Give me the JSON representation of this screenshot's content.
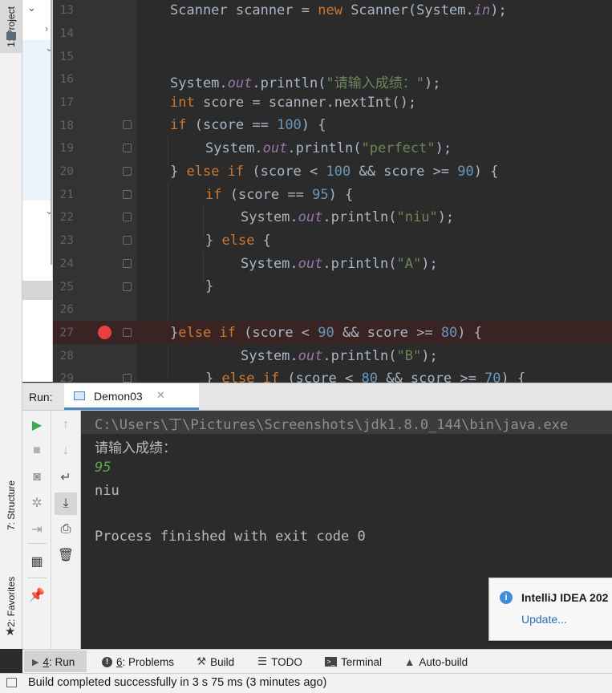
{
  "left_strip": {
    "project_tab": "1: Project",
    "structure_tab": "7: Structure",
    "favorites_tab": "2: Favorites"
  },
  "editor": {
    "lines": [
      {
        "num": "13"
      },
      {
        "num": "14"
      },
      {
        "num": "15"
      },
      {
        "num": "16"
      },
      {
        "num": "17"
      },
      {
        "num": "18"
      },
      {
        "num": "19"
      },
      {
        "num": "20"
      },
      {
        "num": "21"
      },
      {
        "num": "22"
      },
      {
        "num": "23"
      },
      {
        "num": "24"
      },
      {
        "num": "25"
      },
      {
        "num": "26"
      },
      {
        "num": "27"
      },
      {
        "num": "28"
      },
      {
        "num": "29"
      }
    ],
    "tokens": {
      "l13": [
        "Scanner scanner = ",
        "new",
        " Scanner(System.",
        "in",
        ");"
      ],
      "l16": [
        "System.",
        "out",
        ".println(",
        "\"请输入成绩：\"",
        ");"
      ],
      "l17": [
        "int",
        " score = scanner.nextInt();"
      ],
      "l18": [
        "if",
        " (score == ",
        "100",
        ") {"
      ],
      "l19": [
        "System.",
        "out",
        ".println(",
        "\"perfect\"",
        ");"
      ],
      "l20": [
        "} ",
        "else if",
        " (score < ",
        "100",
        " && score >= ",
        "90",
        ") {"
      ],
      "l21": [
        "if",
        " (score == ",
        "95",
        ") {"
      ],
      "l22": [
        "System.",
        "out",
        ".println(",
        "\"niu\"",
        ");"
      ],
      "l23": [
        "} ",
        "else",
        " {"
      ],
      "l24": [
        "System.",
        "out",
        ".println(",
        "\"A\"",
        ");"
      ],
      "l25": [
        "}"
      ],
      "l27": [
        "}",
        "else if",
        " (score < ",
        "90",
        " && score >= ",
        "80",
        ") {"
      ],
      "l28": [
        "System.",
        "out",
        ".println(",
        "\"B\"",
        ");"
      ],
      "l29": [
        "} ",
        "else if",
        " (score < ",
        "80",
        " && score >= ",
        "70",
        ") {"
      ]
    },
    "breakpoint_line": "27",
    "colors": {
      "keyword": "#cc7832",
      "string": "#6a8759",
      "number": "#6897bb",
      "field": "#9876aa",
      "text": "#a9b7c6",
      "breakpoint": "#e84040",
      "breakpoint_line_bg": "#3a2323"
    }
  },
  "run_panel": {
    "label": "Run:",
    "tab": "Demon03",
    "console": [
      "C:\\Users\\丁\\Pictures\\Screenshots\\jdk1.8.0_144\\bin\\java.exe",
      "请输入成绩：",
      "95",
      "niu",
      "",
      "Process finished with exit code 0"
    ]
  },
  "notification": {
    "title": "IntelliJ IDEA 202",
    "link": "Update..."
  },
  "bottom_tabs": [
    {
      "icon": "play-icon",
      "mnemonic": "4",
      "label": ": Run"
    },
    {
      "icon": "problems-icon",
      "mnemonic": "6",
      "label": ": Problems"
    },
    {
      "icon": "hammer-icon",
      "mnemonic": "",
      "label": "Build"
    },
    {
      "icon": "todo-icon",
      "mnemonic": "",
      "label": "TODO"
    },
    {
      "icon": "terminal-icon",
      "mnemonic": "",
      "label": "Terminal"
    },
    {
      "icon": "warning-icon",
      "mnemonic": "",
      "label": "Auto-build"
    }
  ],
  "status": {
    "text": "Build completed successfully in 3 s 75 ms (3 minutes ago)"
  }
}
